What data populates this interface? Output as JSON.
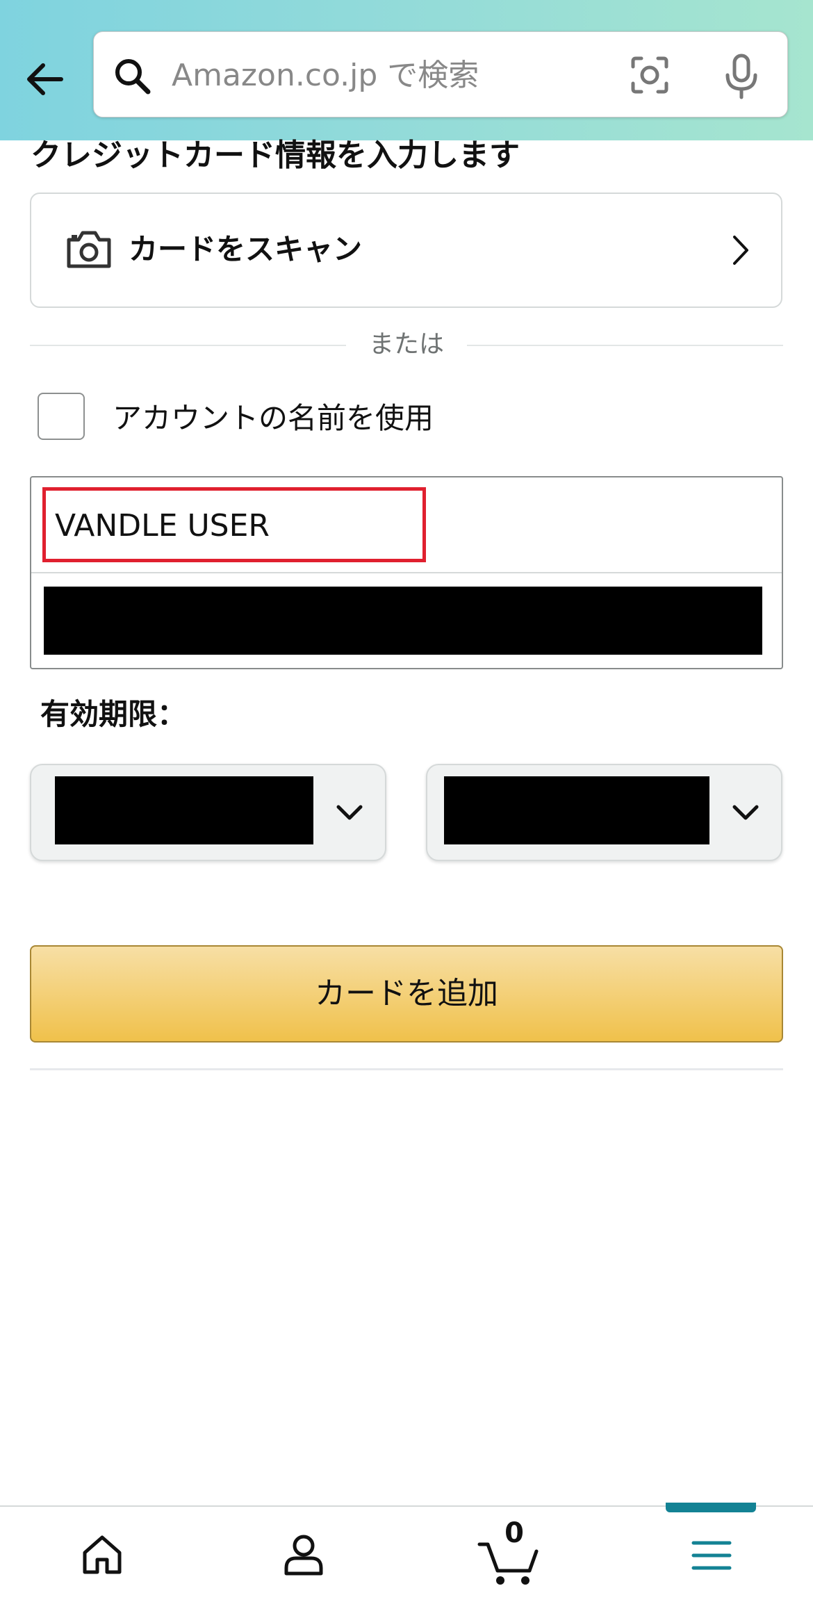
{
  "header": {
    "search_placeholder": "Amazon.co.jp で検索"
  },
  "main": {
    "section_title": "クレジットカード情報を入力します",
    "scan_card_label": "カードをスキャン",
    "or_text": "または",
    "use_account_name_label": "アカウントの名前を使用",
    "use_account_name_checked": false,
    "cardholder_name_value": "VANDLE USER",
    "expiry_label": "有効期限：",
    "add_card_button": "カードを追加"
  },
  "bottom_nav": {
    "cart_count": "0",
    "active_tab": "menu"
  },
  "colors": {
    "header_gradient_start": "#7fd3df",
    "header_gradient_end": "#a6e5cf",
    "highlight_border": "#e0202f",
    "button_yellow": "#f0c14b",
    "active_indicator": "#138294"
  }
}
